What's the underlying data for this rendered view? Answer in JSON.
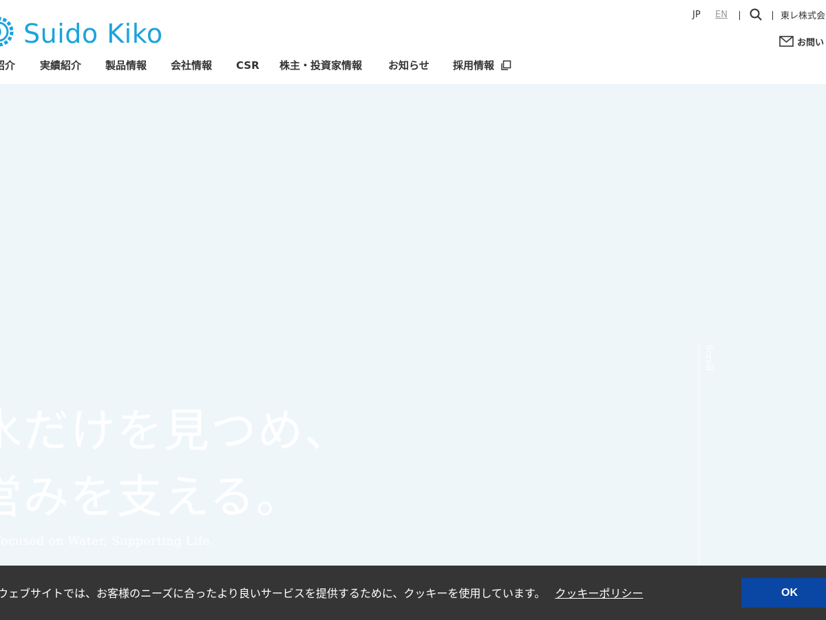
{
  "header": {
    "logo_text": "Suido Kiko",
    "nav": [
      {
        "label": "紹介"
      },
      {
        "label": "実績紹介"
      },
      {
        "label": "製品情報"
      },
      {
        "label": "会社情報"
      },
      {
        "label": "CSR"
      },
      {
        "label": "株主・投資家情報"
      },
      {
        "label": "お知らせ"
      },
      {
        "label": "採用情報"
      }
    ],
    "lang_jp": "JP",
    "lang_en": "EN",
    "corp_link": "東レ株式会",
    "contact_label": "お問い",
    "brand_color": "#1ba3dd"
  },
  "hero": {
    "line1": "水だけを見つめ、",
    "line2": "営みを支える。",
    "subtitle": "Focused on Water, Supporting Life.",
    "scroll_label": "Scroll"
  },
  "cookie": {
    "message": "ウェブサイトでは、お客様のニーズに合ったより良いサービスを提供するために、クッキーを使用しています。",
    "policy_link": "クッキーポリシー",
    "ok_label": "OK",
    "button_color": "#0a46a3"
  }
}
